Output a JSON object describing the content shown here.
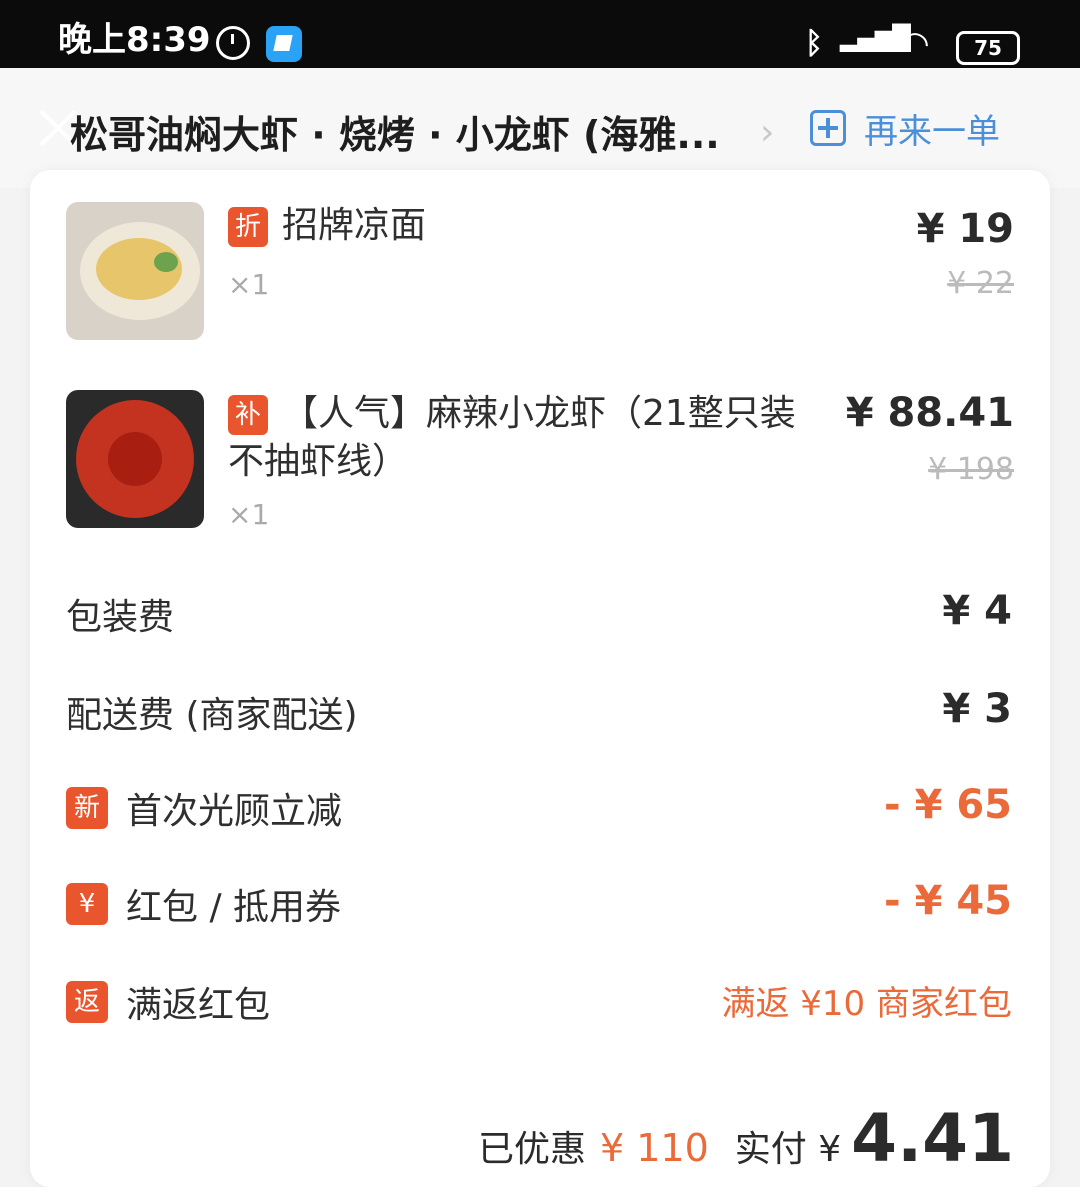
{
  "status_bar": {
    "time": "晚上8:39",
    "battery": "75",
    "icons": [
      "alarm-icon",
      "app-icon",
      "bluetooth-icon",
      "hd-signal-icon",
      "wifi-icon",
      "battery-icon"
    ]
  },
  "header": {
    "shop_name": "松哥油焖大虾 · 烧烤 · 小龙虾 (海雅...",
    "reorder_label": "再来一单"
  },
  "items": [
    {
      "tag": "折",
      "name": "招牌凉面",
      "qty": "×1",
      "price": "¥ 19",
      "original_price": "¥ 22"
    },
    {
      "tag": "补",
      "name": "【人气】麻辣小龙虾（21整只装不抽虾线）",
      "qty": "×1",
      "price": "¥ 88.41",
      "original_price": "¥ 198"
    }
  ],
  "fees": [
    {
      "label": "包装费",
      "value": "¥ 4"
    },
    {
      "label": "配送费 (商家配送)",
      "value": "¥ 3"
    }
  ],
  "discounts": [
    {
      "tag": "新",
      "label": "首次光顾立减",
      "value": "- ¥ 65"
    },
    {
      "tag": "¥",
      "label": "红包 / 抵用券",
      "value": "- ¥ 45"
    },
    {
      "tag": "返",
      "label": "满返红包",
      "value": "满返 ¥10 商家红包"
    }
  ],
  "summary": {
    "saved_label": "已优惠",
    "saved_value": "¥ 110",
    "paid_label": "实付 ¥",
    "paid_value": "4.41"
  },
  "colors": {
    "accent_orange": "#ea6a3a",
    "tag_red": "#e9562e",
    "link_blue": "#4a8fd8"
  }
}
